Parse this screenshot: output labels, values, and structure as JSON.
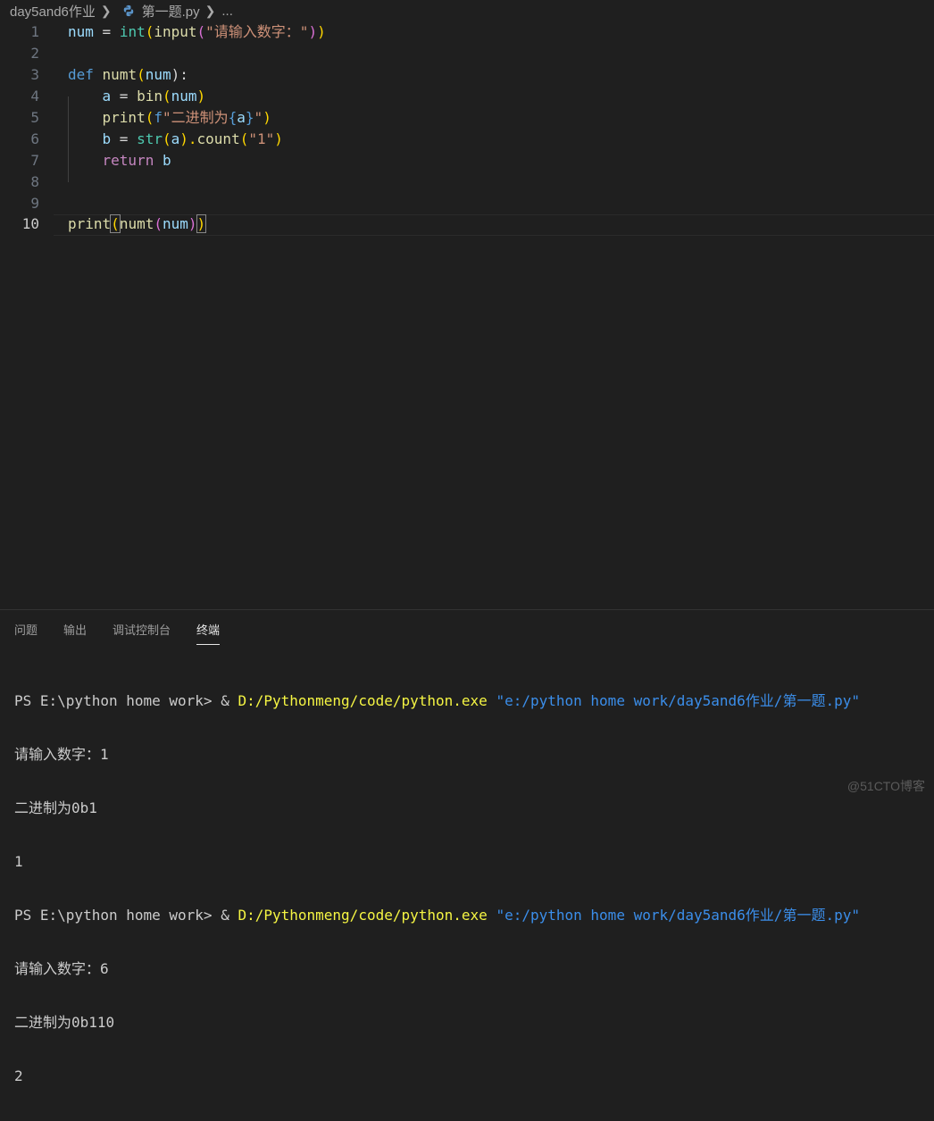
{
  "breadcrumb": {
    "folder": "day5and6作业",
    "file": "第一题.py",
    "more": "..."
  },
  "editor": {
    "active_line": "10",
    "lines": [
      {
        "num": "1",
        "t": [
          "num",
          " = ",
          "int",
          "(",
          "input",
          "(",
          "\"请输入数字：\"",
          ")",
          ")"
        ]
      },
      {
        "num": "2"
      },
      {
        "num": "3",
        "t": [
          "def",
          " ",
          "numt",
          "(",
          "num",
          "):"
        ]
      },
      {
        "num": "4",
        "t": [
          "    ",
          "a",
          " = ",
          "bin",
          "(",
          "num",
          ")"
        ]
      },
      {
        "num": "5",
        "t": [
          "    ",
          "print",
          "(",
          "f",
          "\"二进制为",
          "{",
          "a",
          "}",
          "\"",
          ")"
        ]
      },
      {
        "num": "6",
        "t": [
          "    ",
          "b",
          " = ",
          "str",
          "(",
          "a",
          ").",
          "count",
          "(",
          "\"1\"",
          ")"
        ]
      },
      {
        "num": "7",
        "t": [
          "    ",
          "return",
          " ",
          "b"
        ]
      },
      {
        "num": "8"
      },
      {
        "num": "9"
      },
      {
        "num": "10",
        "t": [
          "print",
          "(",
          "numt",
          "(",
          "num",
          ")",
          ")"
        ]
      }
    ]
  },
  "panel": {
    "tabs": [
      "问题",
      "输出",
      "调试控制台",
      "终端"
    ],
    "active_tab": "终端",
    "terminal": {
      "prompt1": "PS E:\\python home work> ",
      "amp1": "& ",
      "cmd1": "D:/Pythonmeng/code/python.exe",
      "arg1": "\"e:/python home work/day5and6作业/第一题.py\"",
      "out1a": "请输入数字：1",
      "out1b": "二进制为0b1",
      "out1c": "1",
      "prompt2": "PS E:\\python home work> ",
      "amp2": "& ",
      "cmd2": "D:/Pythonmeng/code/python.exe",
      "arg2": "\"e:/python home work/day5and6作业/第一题.py\"",
      "out2a": "请输入数字：6",
      "out2b": "二进制为0b110",
      "out2c": "2"
    }
  },
  "watermark": "@51CTO博客"
}
